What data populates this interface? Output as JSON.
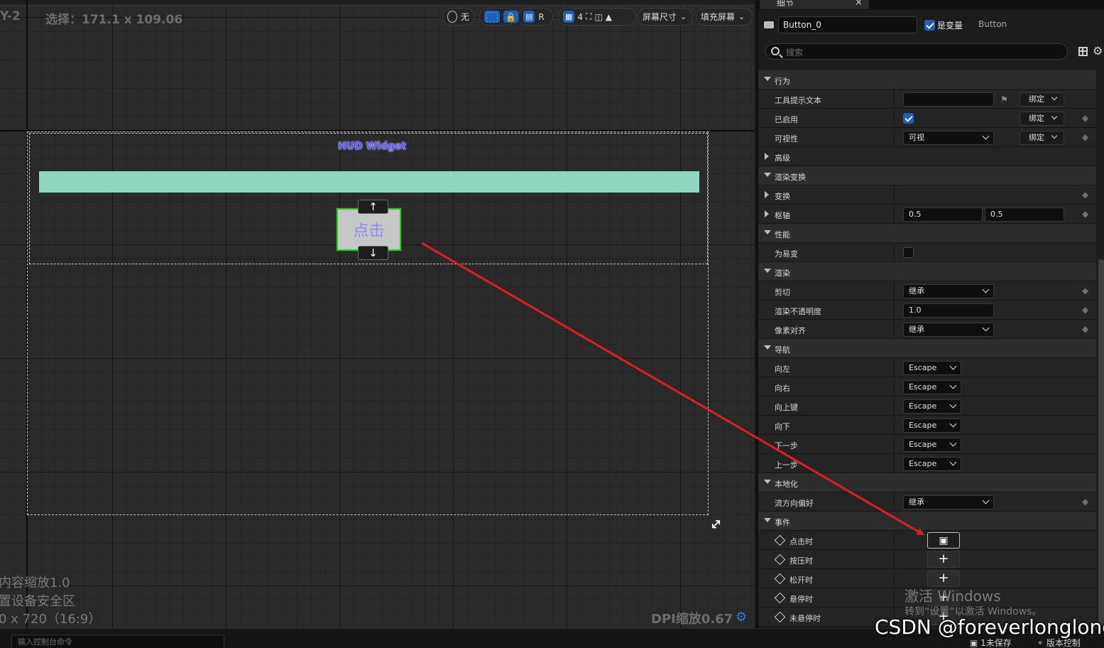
{
  "viewport": {
    "name": "Y-2",
    "selection": "选择：171.1 x 109.06",
    "content_scale": "内容缩放1.0",
    "safe_zone": "置设备安全区",
    "resolution": "0 x 720（16:9）",
    "dpi": "DPI缩放0.67"
  },
  "toolbar": {
    "none_label": "无",
    "r_label": "R",
    "grid_count": "4",
    "screen_size": "屏幕尺寸",
    "fill_screen": "填充屏幕"
  },
  "canvas": {
    "hud_title": "HUD Widget",
    "button_label": "点击",
    "nav_up": "↑",
    "nav_down": "↓"
  },
  "details": {
    "tab_title": "细节",
    "tab_close": "×",
    "widget_name": "Button_0",
    "is_variable_label": "是变量",
    "is_variable": true,
    "widget_type": "Button",
    "search_placeholder": "搜索",
    "rows": {
      "behavior": "行为",
      "tooltip": "工具提示文本",
      "tooltip_bind": "绑定",
      "enabled": "已启用",
      "enabled_bind": "绑定",
      "visibility": "可视性",
      "visibility_value": "可视",
      "visibility_bind": "绑定",
      "advanced": "高级",
      "render_transform": "渲染变换",
      "transform": "变换",
      "pivot": "枢轴",
      "pivot_x": "0.5",
      "pivot_y": "0.5",
      "performance": "性能",
      "volatile": "为易变",
      "rendering": "渲染",
      "clipping": "剪切",
      "clipping_value": "继承",
      "opacity": "渲染不透明度",
      "opacity_value": "1.0",
      "pixel_snap": "像素对齐",
      "pixel_snap_value": "继承",
      "navigation": "导航",
      "nav_left": "向左",
      "nav_right": "向右",
      "nav_up": "向上键",
      "nav_down": "向下",
      "nav_next": "下一步",
      "nav_prev": "上一步",
      "nav_value": "Escape",
      "localization": "本地化",
      "flow_direction": "流方向偏好",
      "flow_direction_value": "继承",
      "events": "事件",
      "on_clicked": "点击时",
      "on_pressed": "按压时",
      "on_released": "松开时",
      "on_hovered": "悬停时",
      "on_unhovered": "未悬停时"
    }
  },
  "overlay": {
    "activate_windows": "激活 Windows",
    "activate_windows_sub": "转到“设置”以激活 Windows。",
    "csdn": "CSDN @foreverlonglong",
    "arrow_color": "#e02020"
  },
  "statusbar": {
    "console_placeholder": "输入控制台命令",
    "unsaved": "1未保存",
    "source_control": "版本控制"
  },
  "colors": {
    "accent": "#1f5fb5",
    "progress_fill": "#8fd6c1",
    "selection_outline": "#22cc22",
    "hud_title": "#5a5cff"
  }
}
